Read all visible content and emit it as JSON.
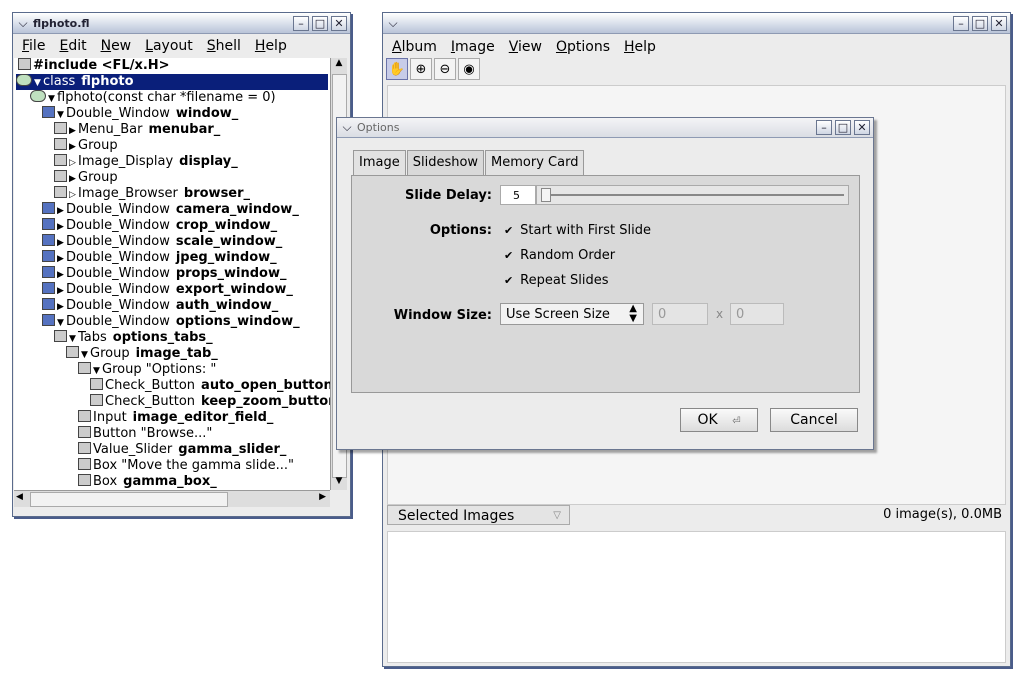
{
  "left_window": {
    "title": "flphoto.fl",
    "menu": [
      "File",
      "Edit",
      "New",
      "Layout",
      "Shell",
      "Help"
    ],
    "tree": [
      {
        "text": "#include <FL/x.H>",
        "name": "",
        "bold_all": true
      },
      {
        "text": "class",
        "name": "flphoto",
        "selected": true
      },
      {
        "text": "flphoto(const char *filename = 0)",
        "name": ""
      },
      {
        "text": "Double_Window",
        "name": "window_"
      },
      {
        "text": "Menu_Bar",
        "name": "menubar_"
      },
      {
        "text": "Group",
        "name": ""
      },
      {
        "text": "Image_Display",
        "name": "display_"
      },
      {
        "text": "Group",
        "name": ""
      },
      {
        "text": "Image_Browser",
        "name": "browser_"
      },
      {
        "text": "Double_Window",
        "name": "camera_window_"
      },
      {
        "text": "Double_Window",
        "name": "crop_window_"
      },
      {
        "text": "Double_Window",
        "name": "scale_window_"
      },
      {
        "text": "Double_Window",
        "name": "jpeg_window_"
      },
      {
        "text": "Double_Window",
        "name": "props_window_"
      },
      {
        "text": "Double_Window",
        "name": "export_window_"
      },
      {
        "text": "Double_Window",
        "name": "auth_window_"
      },
      {
        "text": "Double_Window",
        "name": "options_window_"
      },
      {
        "text": "Tabs",
        "name": "options_tabs_"
      },
      {
        "text": "Group",
        "name": "image_tab_"
      },
      {
        "text": "Group  \"Options: \"",
        "name": ""
      },
      {
        "text": "Check_Button",
        "name": "auto_open_button"
      },
      {
        "text": "Check_Button",
        "name": "keep_zoom_button"
      },
      {
        "text": "Input",
        "name": "image_editor_field_"
      },
      {
        "text": "Button  \"Browse...\"",
        "name": ""
      },
      {
        "text": "Value_Slider",
        "name": "gamma_slider_"
      },
      {
        "text": "Box  \"Move the gamma slide...\"",
        "name": ""
      },
      {
        "text": "Box",
        "name": "gamma_box_"
      }
    ]
  },
  "main_window": {
    "title": "",
    "menu": [
      "Album",
      "Image",
      "View",
      "Options",
      "Help"
    ],
    "selected_images_label": "Selected Images",
    "status": "0 image(s), 0.0MB"
  },
  "dialog": {
    "title": "Options",
    "tabs": [
      "Image",
      "Slideshow",
      "Memory Card"
    ],
    "active_tab": "Slideshow",
    "slide_delay_label": "Slide Delay:",
    "slide_delay_value": "5",
    "options_label": "Options:",
    "checks": [
      "Start with First Slide",
      "Random Order",
      "Repeat Slides"
    ],
    "window_size_label": "Window Size:",
    "window_size_choice": "Use Screen Size",
    "width_value": "0",
    "x_sep": "x",
    "height_value": "0",
    "ok": "OK",
    "cancel": "Cancel"
  }
}
